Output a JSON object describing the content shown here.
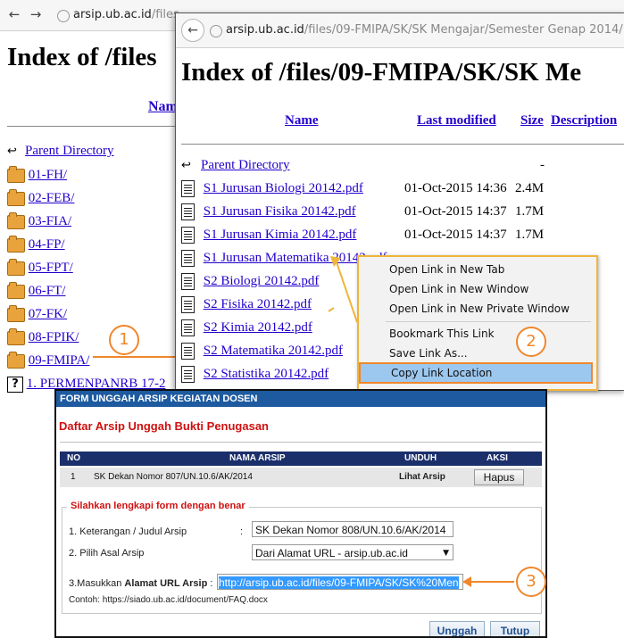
{
  "back_window": {
    "url_host": "arsip.ub.ac.id",
    "url_path": "/files",
    "heading": "Index of /files",
    "col_name": "Nam",
    "items": [
      {
        "label": "Parent Directory",
        "icon": "parent-dir-icon"
      },
      {
        "label": "01-FH/",
        "icon": "folder-icon"
      },
      {
        "label": "02-FEB/",
        "icon": "folder-icon"
      },
      {
        "label": "03-FIA/",
        "icon": "folder-icon"
      },
      {
        "label": "04-FP/",
        "icon": "folder-icon"
      },
      {
        "label": "05-FPT/",
        "icon": "folder-icon"
      },
      {
        "label": "06-FT/",
        "icon": "folder-icon"
      },
      {
        "label": "07-FK/",
        "icon": "folder-icon"
      },
      {
        "label": "08-FPIK/",
        "icon": "folder-icon"
      },
      {
        "label": "09-FMIPA/",
        "icon": "folder-icon"
      },
      {
        "label": "1. PERMENPANRB 17-2",
        "icon": "unknown-file-icon"
      }
    ]
  },
  "front_window": {
    "url_host": "arsip.ub.ac.id",
    "url_path": "/files/09-FMIPA/SK/SK Mengajar/Semester Genap 2014/",
    "heading": "Index of /files/09-FMIPA/SK/SK Me",
    "columns": {
      "name": "Name",
      "modified": "Last modified",
      "size": "Size",
      "desc": "Description"
    },
    "parent": {
      "label": "Parent Directory",
      "size": "-"
    },
    "files": [
      {
        "name": "S1 Jurusan Biologi 20142.pdf",
        "modified": "01-Oct-2015 14:36",
        "size": "2.4M"
      },
      {
        "name": "S1 Jurusan Fisika 20142.pdf",
        "modified": "01-Oct-2015 14:37",
        "size": "1.7M"
      },
      {
        "name": "S1 Jurusan Kimia 20142.pdf",
        "modified": "01-Oct-2015 14:37",
        "size": "1.7M"
      },
      {
        "name": "S1 Jurusan Matematika 20142.pdf",
        "modified": "",
        "size": ""
      },
      {
        "name": "S2 Biologi 20142.pdf",
        "modified": "",
        "size": ""
      },
      {
        "name": "S2 Fisika 20142.pdf",
        "modified": "",
        "size": ""
      },
      {
        "name": "S2 Kimia 20142.pdf",
        "modified": "",
        "size": ""
      },
      {
        "name": "S2 Matematika 20142.pdf",
        "modified": "",
        "size": ""
      },
      {
        "name": "S2 Statistika 20142.pdf",
        "modified": "",
        "size": ""
      }
    ]
  },
  "context_menu": {
    "items": [
      {
        "label": "Open Link in New Tab"
      },
      {
        "label": "Open Link in New Window"
      },
      {
        "label": "Open Link in New Private Window"
      },
      {
        "label": "Bookmark This Link"
      },
      {
        "label": "Save Link As..."
      },
      {
        "label": "Copy Link Location"
      }
    ]
  },
  "steps": {
    "one": "1",
    "two": "2",
    "three": "3"
  },
  "form": {
    "header": "FORM UNGGAH ARSIP KEGIATAN DOSEN",
    "title": "Daftar Arsip Unggah Bukti Penugasan",
    "table": {
      "headers": {
        "no": "NO",
        "nama": "NAMA ARSIP",
        "unduh": "UNDUH",
        "aksi": "AKSI"
      },
      "row": {
        "no": "1",
        "nama": "SK Dekan Nomor 807/UN.10.6/AK/2014",
        "unduh": "Lihat Arsip",
        "aksi": "Hapus"
      }
    },
    "section_title": "Silahkan lengkapi form dengan benar",
    "field1_label": "1. Keterangan / Judul Arsip",
    "field1_value": "SK Dekan Nomor 808/UN.10.6/AK/2014",
    "field2_label": "2. Pilih Asal Arsip",
    "field2_value": "Dari Alamat URL - arsip.ub.ac.id",
    "field3_label_pre": "3.Masukkan",
    "field3_label_bold": "Alamat URL Arsip",
    "field3_value": "http://arsip.ub.ac.id/files/09-FMIPA/SK/SK%20Men",
    "colon": ":",
    "example": "Contoh: https://siado.ub.ac.id/document/FAQ.docx",
    "upload_btn": "Unggah",
    "close_btn": "Tutup"
  },
  "colors": {
    "accent_orange": "#f0872b",
    "form_header_blue": "#1e5aa0",
    "title_red": "#d01010",
    "link": "#2200cc"
  }
}
